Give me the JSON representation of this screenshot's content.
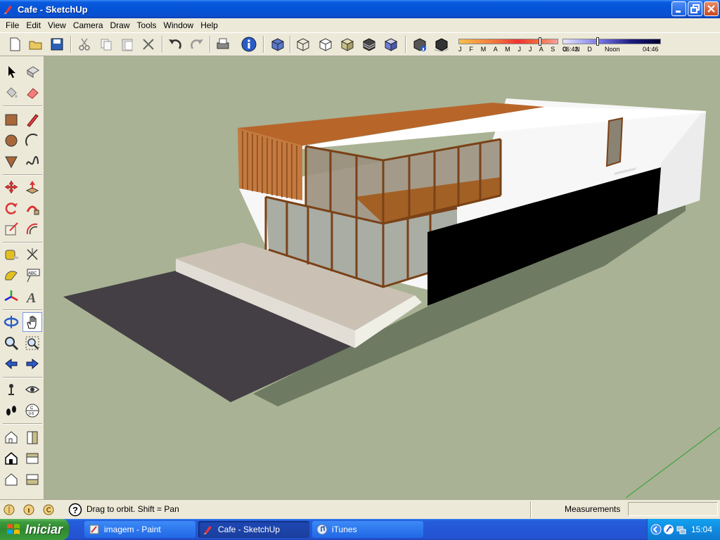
{
  "window": {
    "title": "Cafe - SketchUp"
  },
  "menu": [
    "File",
    "Edit",
    "View",
    "Camera",
    "Draw",
    "Tools",
    "Window",
    "Help"
  ],
  "shadow_settings": {
    "months": "J F M A M J J A S O N D",
    "time_start": "06:42",
    "time_noon": "Noon",
    "time_end": "04:46"
  },
  "status": {
    "hint": "Drag to orbit.  Shift = Pan",
    "measurements_label": "Measurements",
    "measurements_value": ""
  },
  "taskbar": {
    "start_label": "Iniciar",
    "tasks": [
      {
        "label": "imagem - Paint"
      },
      {
        "label": "Cafe - SketchUp"
      },
      {
        "label": "iTunes"
      }
    ],
    "clock": "15:04"
  },
  "colors": {
    "sky_ground": "#a9b294",
    "wood": "#b8652a",
    "xp_blue": "#0553d6"
  }
}
